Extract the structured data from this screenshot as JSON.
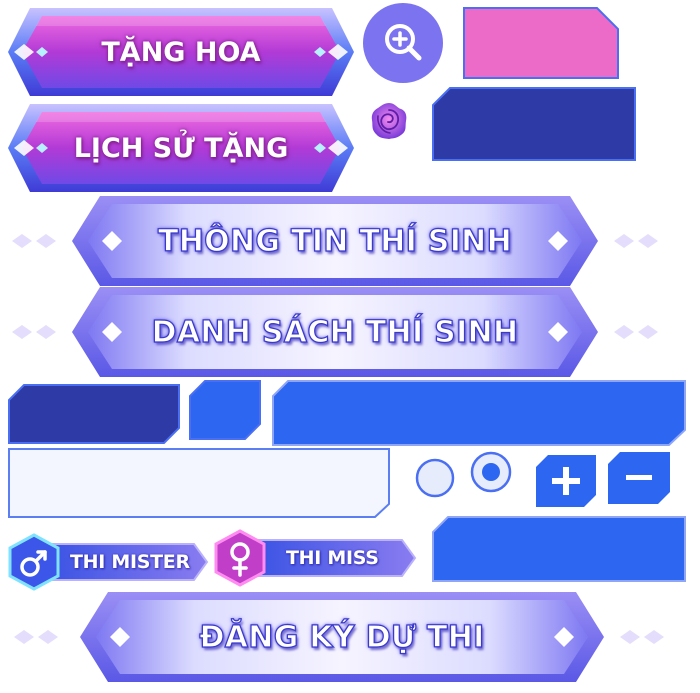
{
  "buttons": {
    "gift_flower": "TẶNG HOA",
    "gift_history": "LỊCH SỬ TẶNG",
    "contestant_info": "THÔNG TIN THÍ SINH",
    "contestant_list": "DANH SÁCH THÍ SINH",
    "mister_tab": "THI MISTER",
    "miss_tab": "THI MISS",
    "register": "ĐĂNG KÝ DỰ THI"
  },
  "icons": {
    "zoom": "zoom-in-icon",
    "rose": "rose-icon",
    "male": "male-symbol-icon",
    "female": "female-symbol-icon",
    "plus": "plus-icon",
    "minus": "minus-icon"
  },
  "colors": {
    "pink_panel": "#ed6bc8",
    "navy": "#2e3aa5",
    "blue": "#2d66f0",
    "accent_violet": "#7b73f0",
    "magenta": "#c13ec9"
  }
}
